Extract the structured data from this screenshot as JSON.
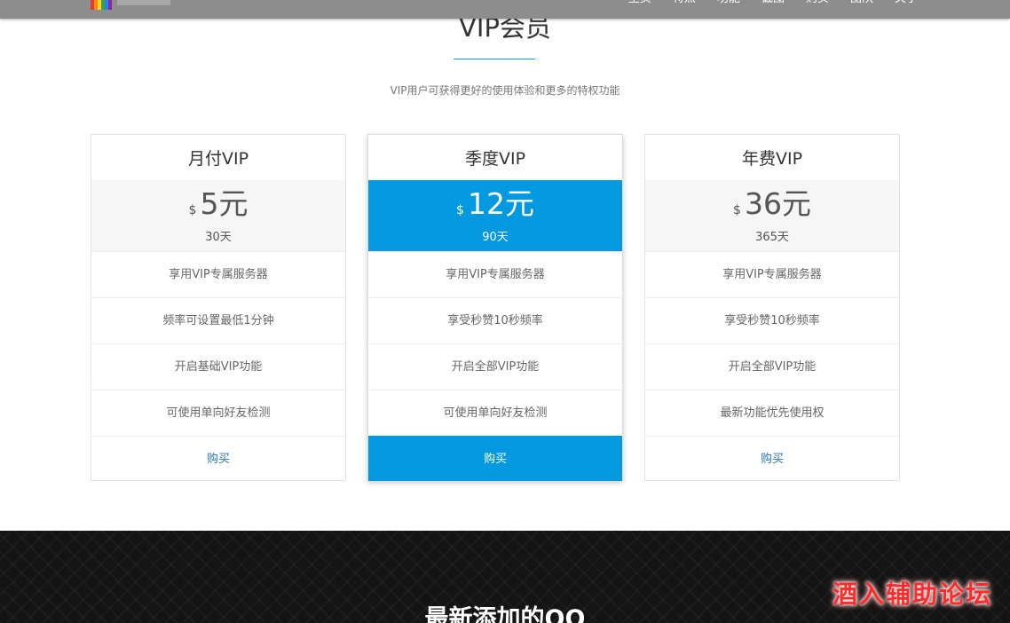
{
  "nav": {
    "items": [
      "主页",
      "特点",
      "功能",
      "截图",
      "购买",
      "团队",
      "关于"
    ]
  },
  "section": {
    "title": "VIP会员",
    "subtitle": "VIP用户可获得更好的使用体验和更多的特权功能"
  },
  "plans": [
    {
      "name": "月付VIP",
      "currency": "$",
      "price": "5元",
      "period": "30天",
      "features": [
        "享用VIP专属服务器",
        "频率可设置最低1分钟",
        "开启基础VIP功能",
        "可使用单向好友检测"
      ],
      "buy_label": "购买"
    },
    {
      "name": "季度VIP",
      "currency": "$",
      "price": "12元",
      "period": "90天",
      "features": [
        "享用VIP专属服务器",
        "享受秒赞10秒频率",
        "开启全部VIP功能",
        "可使用单向好友检测"
      ],
      "buy_label": "购买"
    },
    {
      "name": "年费VIP",
      "currency": "$",
      "price": "36元",
      "period": "365天",
      "features": [
        "享用VIP专属服务器",
        "享受秒赞10秒频率",
        "开启全部VIP功能",
        "最新功能优先使用权"
      ],
      "buy_label": "购买"
    }
  ],
  "dark_section": {
    "title": "最新添加的QQ"
  },
  "watermark": "酒入辅助论坛",
  "colors": {
    "accent": "#0399e0",
    "link": "#2a72b5"
  }
}
